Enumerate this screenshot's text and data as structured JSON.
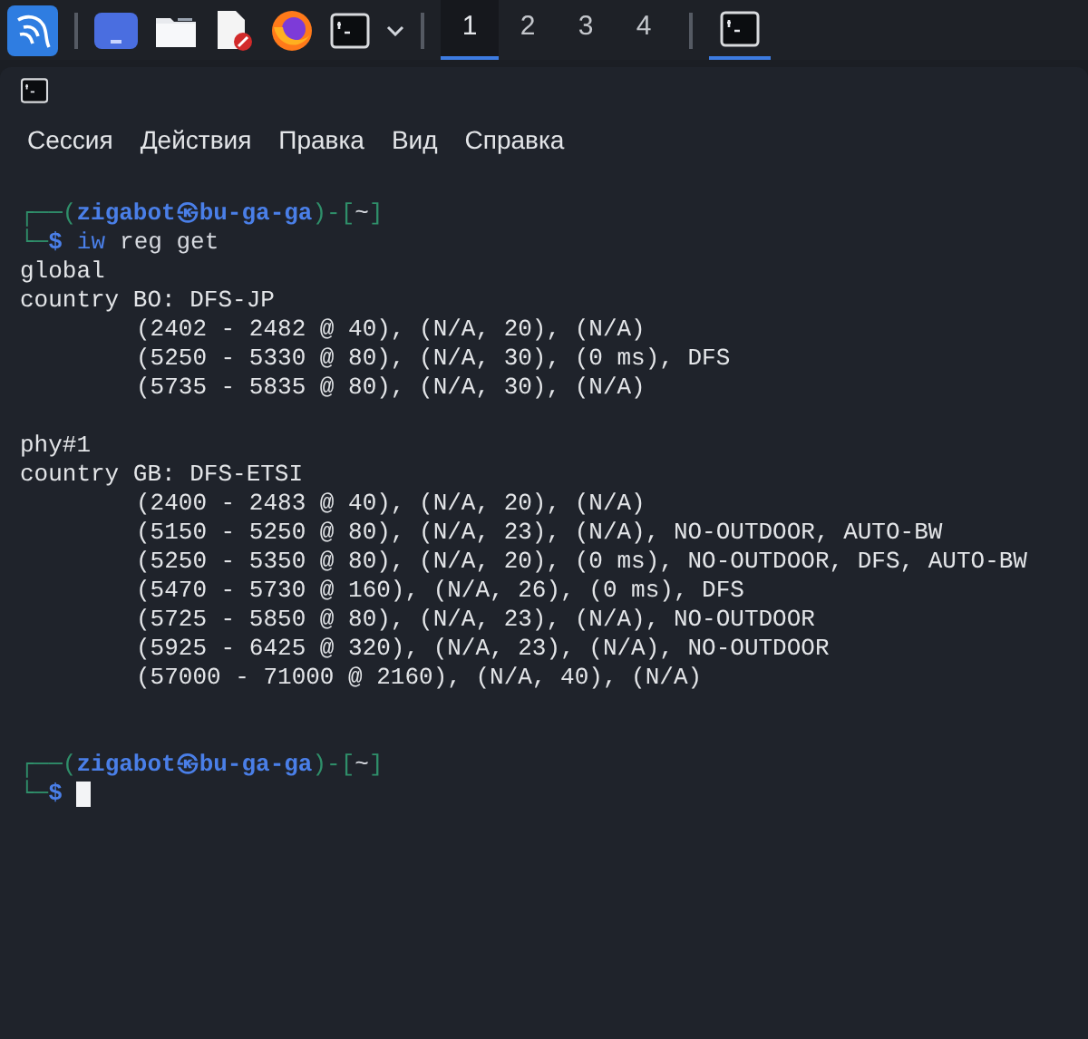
{
  "taskbar": {
    "launchers": [
      {
        "kind": "kali"
      },
      {
        "kind": "desktop"
      },
      {
        "kind": "folder"
      },
      {
        "kind": "editor"
      },
      {
        "kind": "browser"
      },
      {
        "kind": "terminal"
      },
      {
        "kind": "chevron"
      }
    ],
    "workspaces": [
      {
        "label": "1",
        "selected": true
      },
      {
        "label": "2",
        "selected": false
      },
      {
        "label": "3",
        "selected": false
      },
      {
        "label": "4",
        "selected": false
      }
    ],
    "tasks": [
      {
        "kind": "terminal",
        "selected": true
      }
    ]
  },
  "menu": [
    "Сессия",
    "Действия",
    "Правка",
    "Вид",
    "Справка"
  ],
  "terminal": {
    "lines": [
      {
        "kind": "prompt",
        "open": "┌──(",
        "user": "zigabot㉿bu-ga-ga",
        "middle": ")-[",
        "dir": "~",
        "close": "]"
      },
      {
        "kind": "input",
        "frame": "└─",
        "sign": "$",
        "program": "iw",
        "args": "reg get",
        "cursor": false
      },
      {
        "kind": "output",
        "indent": false,
        "text": "global"
      },
      {
        "kind": "output",
        "indent": false,
        "text": "country BO: DFS-JP"
      },
      {
        "kind": "output",
        "indent": true,
        "text": "(2402 - 2482 @ 40), (N/A, 20), (N/A)"
      },
      {
        "kind": "output",
        "indent": true,
        "text": "(5250 - 5330 @ 80), (N/A, 30), (0 ms), DFS"
      },
      {
        "kind": "output",
        "indent": true,
        "text": "(5735 - 5835 @ 80), (N/A, 30), (N/A)"
      },
      {
        "kind": "blank"
      },
      {
        "kind": "output",
        "indent": false,
        "text": "phy#1"
      },
      {
        "kind": "output",
        "indent": false,
        "text": "country GB: DFS-ETSI"
      },
      {
        "kind": "output",
        "indent": true,
        "text": "(2400 - 2483 @ 40), (N/A, 20), (N/A)"
      },
      {
        "kind": "output",
        "indent": true,
        "text": "(5150 - 5250 @ 80), (N/A, 23), (N/A), NO-OUTDOOR, AUTO-BW"
      },
      {
        "kind": "output",
        "indent": true,
        "text": "(5250 - 5350 @ 80), (N/A, 20), (0 ms), NO-OUTDOOR, DFS, AUTO-BW"
      },
      {
        "kind": "output",
        "indent": true,
        "text": "(5470 - 5730 @ 160), (N/A, 26), (0 ms), DFS"
      },
      {
        "kind": "output",
        "indent": true,
        "text": "(5725 - 5850 @ 80), (N/A, 23), (N/A), NO-OUTDOOR"
      },
      {
        "kind": "output",
        "indent": true,
        "text": "(5925 - 6425 @ 320), (N/A, 23), (N/A), NO-OUTDOOR"
      },
      {
        "kind": "output",
        "indent": true,
        "text": "(57000 - 71000 @ 2160), (N/A, 40), (N/A)"
      },
      {
        "kind": "blank"
      },
      {
        "kind": "blank"
      },
      {
        "kind": "prompt",
        "open": "┌──(",
        "user": "zigabot㉿bu-ga-ga",
        "middle": ")-[",
        "dir": "~",
        "close": "]"
      },
      {
        "kind": "input",
        "frame": "└─",
        "sign": "$",
        "cursor": true
      }
    ]
  }
}
